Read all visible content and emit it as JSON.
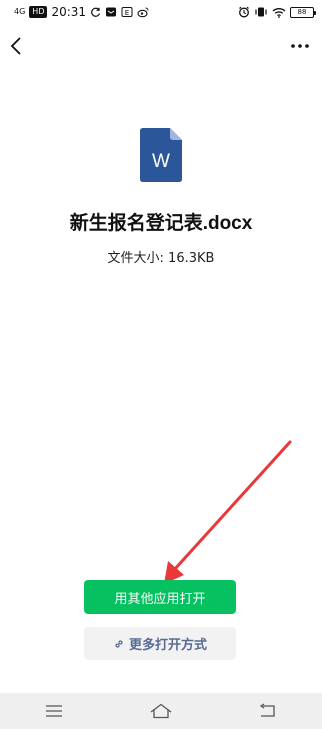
{
  "status_bar": {
    "network": "4G",
    "hd": "HD",
    "time": "20:31",
    "battery": "88"
  },
  "file": {
    "icon_letter": "W",
    "name": "新生报名登记表.docx",
    "size_text": "文件大小: 16.3KB"
  },
  "actions": {
    "open_other_app": "用其他应用打开",
    "more_open_ways": "更多打开方式"
  },
  "colors": {
    "primary_green": "#07c160",
    "link_blue": "#576b95",
    "word_blue": "#2b579a",
    "arrow_red": "#e8383a"
  }
}
